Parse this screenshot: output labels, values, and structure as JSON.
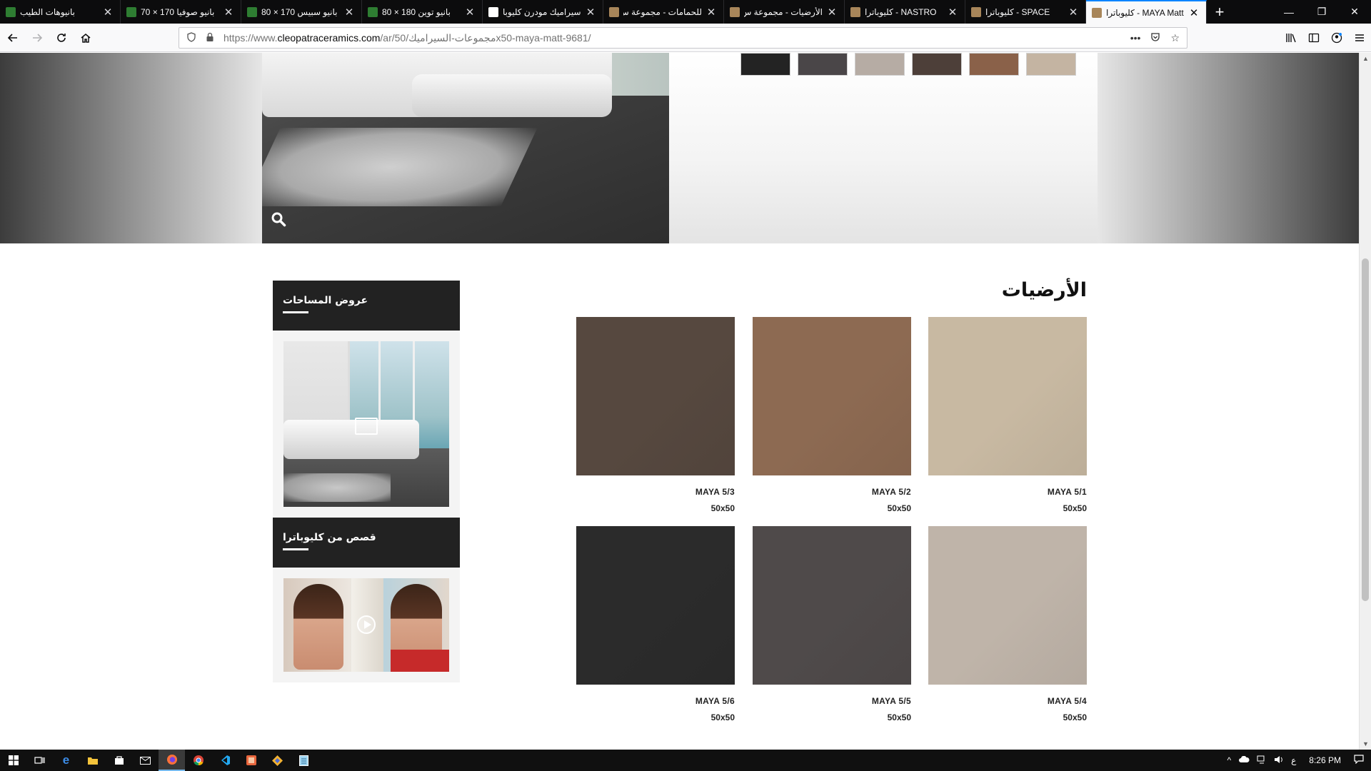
{
  "browser": {
    "tabs": [
      {
        "title": "بانيوهات الطيب",
        "favicon_color": "#2e7d32",
        "active": false
      },
      {
        "title": "بانيو صوفيا 170 × 70",
        "favicon_color": "#2e7d32",
        "active": false
      },
      {
        "title": "بانيو سبيس 170 × 80",
        "favicon_color": "#2e7d32",
        "active": false
      },
      {
        "title": "بانيو توين 180 × 80",
        "favicon_color": "#2e7d32",
        "active": false
      },
      {
        "title": "سيراميك مودرن كليوبا",
        "favicon_color": "#ffffff",
        "active": false
      },
      {
        "title": "للحمامات - مجموعة س",
        "favicon_color": "#a8865a",
        "active": false
      },
      {
        "title": "الأرضيات - مجموعة س",
        "favicon_color": "#a8865a",
        "active": false
      },
      {
        "title": "NASTRO - كليوباترا",
        "favicon_color": "#a8865a",
        "active": false
      },
      {
        "title": "SPACE - كليوباترا",
        "favicon_color": "#a8865a",
        "active": false
      },
      {
        "title": "MAYA Matt - كليوباترا",
        "favicon_color": "#a8865a",
        "active": true
      }
    ],
    "new_tab_label": "+",
    "url_prefix": "https://www.",
    "url_domain": "cleopatraceramics.com",
    "url_path": "/ar/50/مجموعات-السيراميكx50-maya-matt-9681/",
    "window_controls": {
      "minimize": "—",
      "restore": "❐",
      "close": "✕"
    }
  },
  "page": {
    "hero": {
      "swatch_colors": [
        "#232323",
        "#4a4648",
        "#b6aca4",
        "#4d3f39",
        "#8a6149",
        "#c4b4a2"
      ],
      "zoom_icon": "search-icon"
    },
    "floors": {
      "title": "الأرضيات",
      "tiles": [
        {
          "name": "MAYA 5/1",
          "size": "50x50",
          "color": "#c8b9a2",
          "col": 0,
          "row": 0
        },
        {
          "name": "MAYA 5/2",
          "size": "50x50",
          "color": "#8d6a52",
          "col": 1,
          "row": 0
        },
        {
          "name": "MAYA 5/3",
          "size": "50x50",
          "color": "#56483f",
          "col": 2,
          "row": 0
        },
        {
          "name": "MAYA 5/4",
          "size": "50x50",
          "color": "#bfb4a9",
          "col": 0,
          "row": 1
        },
        {
          "name": "MAYA 5/5",
          "size": "50x50",
          "color": "#4f4a4a",
          "col": 1,
          "row": 1
        },
        {
          "name": "MAYA 5/6",
          "size": "50x50",
          "color": "#2b2b2b",
          "col": 2,
          "row": 1
        }
      ]
    },
    "sidebar": {
      "promo_title": "عروض المساحات",
      "stories_title": "قصص من كليوباترا"
    }
  },
  "taskbar": {
    "language": "ع",
    "time": "8:26 PM"
  }
}
